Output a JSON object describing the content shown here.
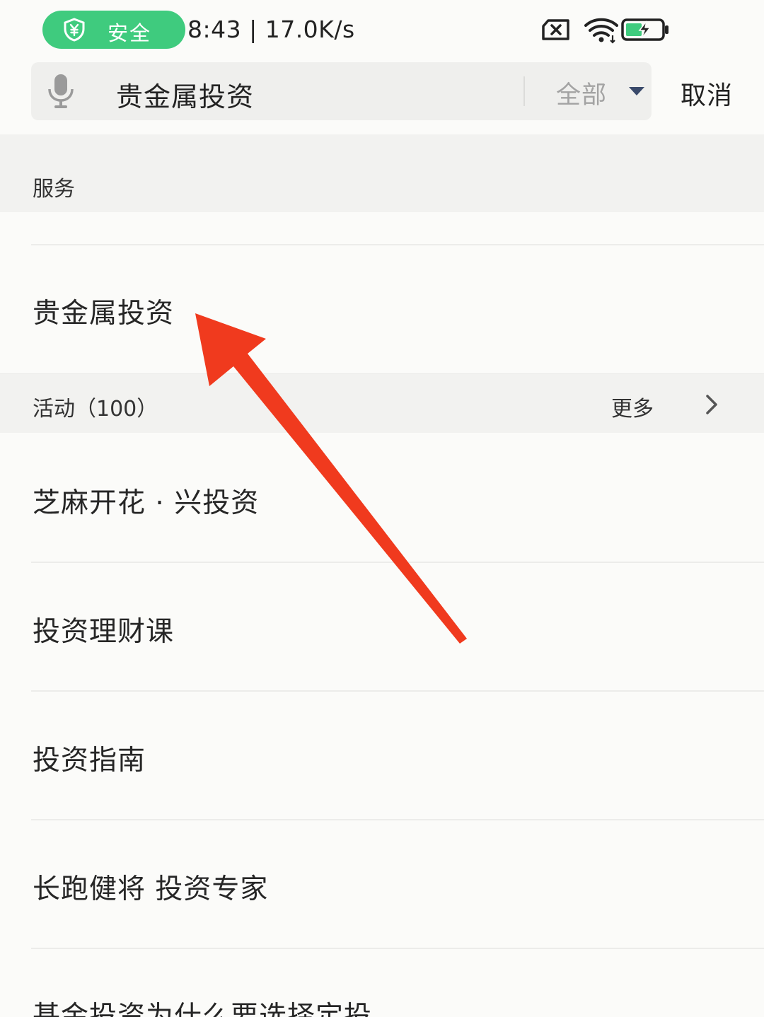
{
  "status_bar": {
    "security_label": "安全",
    "time_speed": "8:43 | 17.0K/s",
    "icons": [
      "shield-yuan-icon",
      "no-sim-icon",
      "wifi-icon",
      "battery-charging-icon"
    ]
  },
  "search": {
    "query": "贵金属投资",
    "scope": "全部",
    "cancel_label": "取消"
  },
  "sections": {
    "service": {
      "title": "服务",
      "items": [
        {
          "label": "贵金属投资"
        }
      ]
    },
    "activity": {
      "title": "活动（100）",
      "more_label": "更多",
      "items": [
        {
          "label": "芝麻开花 · 兴投资"
        },
        {
          "label": "投资理财课"
        },
        {
          "label": "投资指南"
        },
        {
          "label": "长跑健将 投资专家"
        },
        {
          "label": "基金投资为什么要选择定投"
        }
      ]
    }
  },
  "colors": {
    "security_green": "#3fcb7e",
    "annotation_red": "#f03a1e",
    "section_bg": "#f2f2f0",
    "page_bg": "#fbfbf9"
  }
}
